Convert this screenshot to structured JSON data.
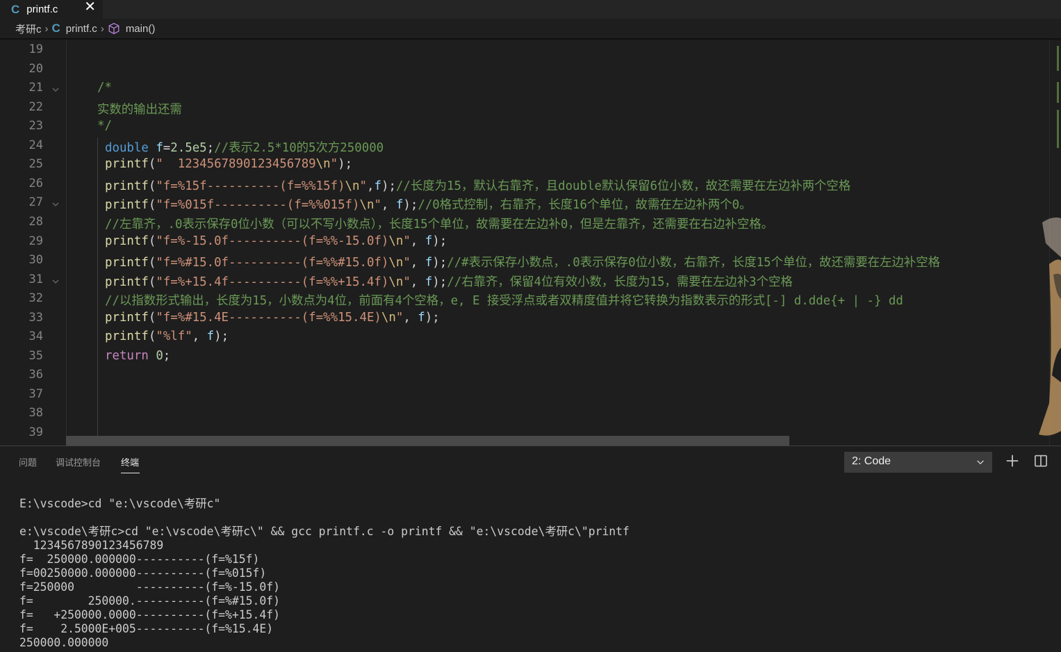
{
  "tab": {
    "icon": "c-language-icon",
    "title": "printf.c",
    "close": "✕"
  },
  "breadcrumb": {
    "folder": "考研c",
    "file": "printf.c",
    "symbol": "main()"
  },
  "editor": {
    "lines": [
      {
        "n": "19",
        "t": ""
      },
      {
        "n": "20",
        "t": ""
      },
      {
        "n": "21",
        "t": "/*"
      },
      {
        "n": "22",
        "t": "实数的输出还需"
      },
      {
        "n": "23",
        "t": "*/"
      },
      {
        "n": "24",
        "t": "double f=2.5e5;//表示2.5*10的5次方250000"
      },
      {
        "n": "25",
        "t": "printf(\"  1234567890123456789\\n\");"
      },
      {
        "n": "26",
        "t": "printf(\"f=%15f----------(f=%%15f)\\n\",f);//长度为15，默认右靠齐，且double默认保留6位小数，故还需要在左边补两个空格"
      },
      {
        "n": "27",
        "t": "printf(\"f=%015f----------(f=%%015f)\\n\", f);//0格式控制，右靠齐，长度16个单位，故需在左边补两个0。"
      },
      {
        "n": "28",
        "t": "//左靠齐，.0表示保存0位小数（可以不写小数点），长度15个单位，故需要在左边补0，但是左靠齐，还需要在右边补空格。"
      },
      {
        "n": "29",
        "t": "printf(\"f=%-15.0f----------(f=%%-15.0f)\\n\", f);"
      },
      {
        "n": "30",
        "t": "printf(\"f=%#15.0f----------(f=%%#15.0f)\\n\", f);//#表示保存小数点，.0表示保存0位小数，右靠齐，长度15个单位，故还需要在左边补空格"
      },
      {
        "n": "31",
        "t": "printf(\"f=%+15.4f----------(f=%%+15.4f)\\n\", f);//右靠齐，保留4位有效小数，长度为15，需要在左边补3个空格"
      },
      {
        "n": "32",
        "t": "//以指数形式输出，长度为15，小数点为4位，前面有4个空格，e, E 接受浮点或者双精度值并将它转换为指数表示的形式[-] d.dde{+ | -} dd"
      },
      {
        "n": "33",
        "t": "printf(\"f=%#15.4E----------(f=%%15.4E)\\n\", f);"
      },
      {
        "n": "34",
        "t": "printf(\"%lf\", f);"
      },
      {
        "n": "35",
        "t": "return 0;"
      },
      {
        "n": "36",
        "t": ""
      },
      {
        "n": "37",
        "t": ""
      },
      {
        "n": "38",
        "t": ""
      },
      {
        "n": "39",
        "t": ""
      }
    ]
  },
  "panel": {
    "tabs": [
      "问题",
      "调试控制台",
      "终端"
    ],
    "active_tab": "终端",
    "terminal_select": "2: Code",
    "add_icon": "plus-icon",
    "split_icon": "split-terminal-icon"
  },
  "terminal": {
    "lines": [
      "E:\\vscode>cd \"e:\\vscode\\考研c\"",
      "",
      "e:\\vscode\\考研c>cd \"e:\\vscode\\考研c\\\" && gcc printf.c -o printf && \"e:\\vscode\\考研c\\\"printf",
      "  1234567890123456789",
      "f=  250000.000000----------(f=%15f)",
      "f=00250000.000000----------(f=%015f)",
      "f=250000         ----------(f=%-15.0f)",
      "f=        250000.----------(f=%#15.0f)",
      "f=   +250000.0000----------(f=%+15.4f)",
      "f=    2.5000E+005----------(f=%15.4E)",
      "250000.000000"
    ]
  },
  "colors": {
    "keyword": "#569cd6",
    "function": "#dcdcaa",
    "variable": "#9cdcfe",
    "string": "#ce9178",
    "number": "#b5cea8",
    "comment": "#6a9955",
    "control": "#c586c0",
    "background": "#1e1e1e"
  }
}
